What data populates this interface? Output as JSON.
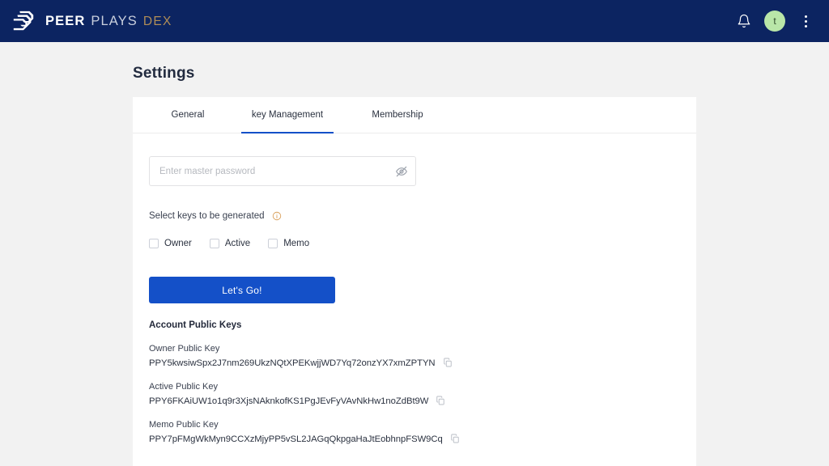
{
  "header": {
    "brand": {
      "peer": "PEER",
      "plays": "PLAYS",
      "dex": "DEX",
      "logo_icon": "peerplays-logo-icon"
    },
    "notifications_icon": "bell-icon",
    "avatar_initial": "t",
    "menu_icon": "kebab-menu-icon",
    "background_color": "#0c2461",
    "accent_color": "#b08d57"
  },
  "page": {
    "title": "Settings"
  },
  "tabs": [
    {
      "label": "General",
      "active": false
    },
    {
      "label": "key Management",
      "active": true
    },
    {
      "label": "Membership",
      "active": false
    }
  ],
  "form": {
    "password": {
      "value": "",
      "placeholder": "Enter master password",
      "toggle_icon": "eye-slash-icon"
    },
    "select_keys_label": "Select keys to be generated",
    "info_icon": "info-circle-icon",
    "info_icon_color": "#d9a05b",
    "checkboxes": [
      {
        "label": "Owner",
        "checked": false
      },
      {
        "label": "Active",
        "checked": false
      },
      {
        "label": "Memo",
        "checked": false
      }
    ],
    "submit_label": "Let's Go!",
    "submit_color": "#1450c8"
  },
  "account_keys": {
    "heading": "Account Public Keys",
    "items": [
      {
        "label": "Owner Public Key",
        "value": "PPY5kwsiwSpx2J7nm269UkzNQtXPEKwjjWD7Yq72onzYX7xmZPTYN",
        "copy_icon": "copy-icon"
      },
      {
        "label": "Active Public Key",
        "value": "PPY6FKAiUW1o1q9r3XjsNAknkofKS1PgJEvFyVAvNkHw1noZdBt9W",
        "copy_icon": "copy-icon"
      },
      {
        "label": "Memo Public Key",
        "value": "PPY7pFMgWkMyn9CCXzMjyPP5vSL2JAGqQkpgaHaJtEobhnpFSW9Cq",
        "copy_icon": "copy-icon"
      }
    ]
  }
}
